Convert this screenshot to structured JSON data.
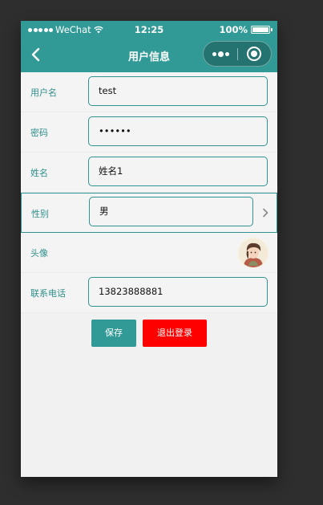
{
  "status_bar": {
    "carrier": "WeChat",
    "time": "12:25",
    "battery": "100%",
    "battery_level": 1.0
  },
  "nav": {
    "title": "用户信息",
    "back_icon": "chevron-left-icon",
    "more_icon": "more-dots-icon",
    "close_icon": "target-circle-icon"
  },
  "form": {
    "username_label": "用户名",
    "username_value": "test",
    "password_label": "密码",
    "password_value": "••••••",
    "name_label": "姓名",
    "name_value": "姓名1",
    "gender_label": "性别",
    "gender_value": "男",
    "avatar_label": "头像",
    "phone_label": "联系电话",
    "phone_value": "13823888881"
  },
  "actions": {
    "save_label": "保存",
    "logout_label": "退出登录"
  },
  "colors": {
    "accent": "#319a97",
    "danger": "#ff0000",
    "background": "#2e2e2e"
  }
}
